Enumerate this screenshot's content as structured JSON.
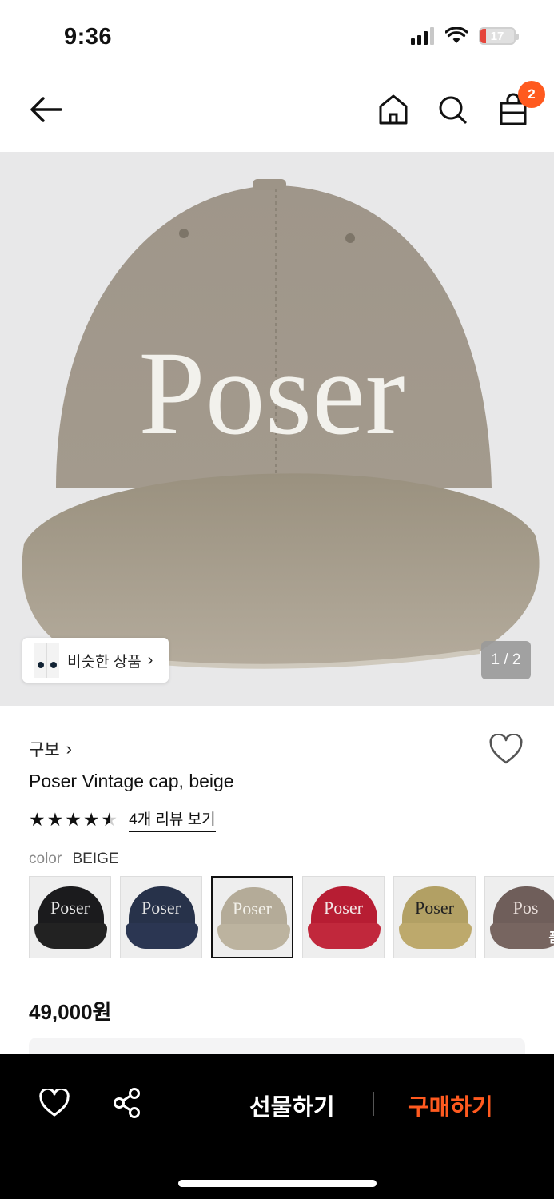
{
  "status_bar": {
    "time": "9:36",
    "battery": "17"
  },
  "nav": {
    "cart_count": "2"
  },
  "hero": {
    "cap_text": "Poser",
    "cap_color": "#a59c8c",
    "similar_label": "비슷한 상품",
    "page_indicator": "1 / 2"
  },
  "product": {
    "brand": "구보",
    "title": "Poser Vintage cap, beige",
    "rating": 4.5,
    "review_link": "4개 리뷰 보기",
    "color_label": "color",
    "color_value": "BEIGE",
    "swatches": [
      {
        "text": "Poser",
        "crown": "#1b1b1d",
        "brim": "#222",
        "text_color": "#e9e9e9"
      },
      {
        "text": "Poser",
        "crown": "#27324a",
        "brim": "#2b3652",
        "text_color": "#e4e4e4"
      },
      {
        "text": "Poser",
        "crown": "#b4ab98",
        "brim": "#bcb39f",
        "text_color": "#f3f1ea",
        "selected": true
      },
      {
        "text": "Poser",
        "crown": "#b71d33",
        "brim": "#c1283c",
        "text_color": "#f2e5e5"
      },
      {
        "text": "Poser",
        "crown": "#b2a064",
        "brim": "#bda96c",
        "text_color": "#222"
      },
      {
        "text": "Pos",
        "crown": "#6f5e5a",
        "brim": "#776560",
        "text_color": "#e7dcd8",
        "overlay": "품"
      }
    ],
    "price": "49,000원"
  },
  "bottom_bar": {
    "gift_label": "선물하기",
    "buy_label": "구매하기",
    "accent": "#ff5a1f"
  }
}
